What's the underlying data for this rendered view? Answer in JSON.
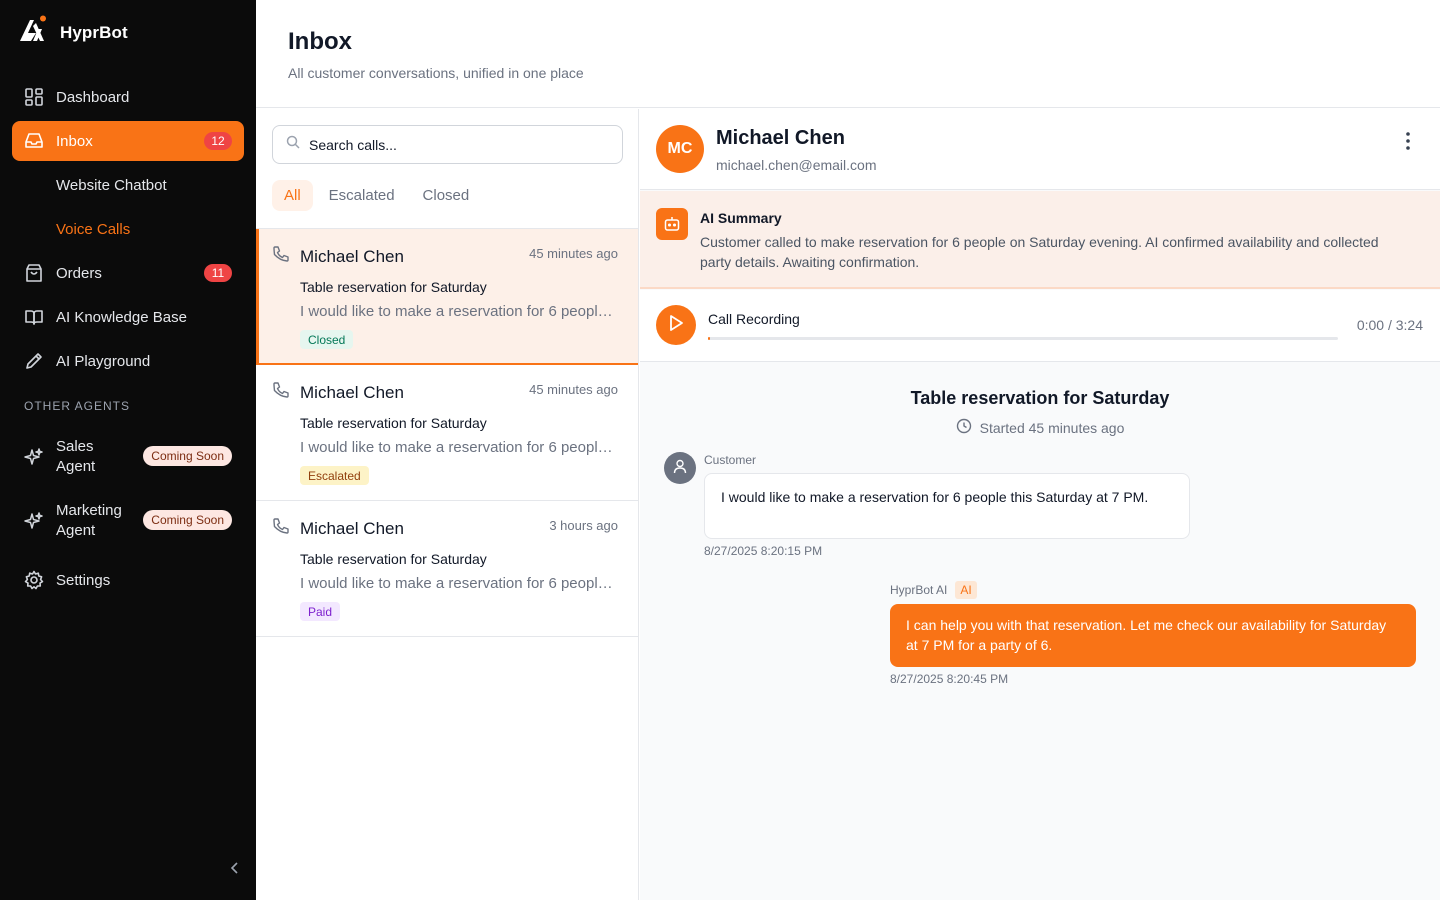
{
  "brand": {
    "name": "HyprBot",
    "logo_icon": "hyprbot-logo"
  },
  "sidebar": {
    "items": [
      {
        "label": "Dashboard",
        "icon": "dashboard-icon"
      },
      {
        "label": "Inbox",
        "icon": "inbox-icon",
        "badge": "12",
        "active": true
      },
      {
        "label": "Orders",
        "icon": "bag-icon",
        "badge": "11"
      },
      {
        "label": "AI Knowledge Base",
        "icon": "book-icon"
      },
      {
        "label": "AI Playground",
        "icon": "pencil-icon"
      }
    ],
    "sub_items": [
      {
        "label": "Website Chatbot"
      },
      {
        "label": "Voice Calls",
        "current": true
      }
    ],
    "section_label": "OTHER AGENTS",
    "agents": [
      {
        "line1": "Sales",
        "line2": "Agent",
        "badge": "Coming Soon",
        "icon": "sparkle-icon"
      },
      {
        "line1": "Marketing",
        "line2": "Agent",
        "badge": "Coming Soon",
        "icon": "sparkle-icon"
      }
    ],
    "settings_label": "Settings"
  },
  "header": {
    "title": "Inbox",
    "subtitle": "All customer conversations, unified in one place"
  },
  "list": {
    "search_placeholder": "Search calls...",
    "filters": [
      "All",
      "Escalated",
      "Closed"
    ],
    "active_filter": "All",
    "conversations": [
      {
        "name": "Michael Chen",
        "time": "45 minutes ago",
        "subject": "Table reservation for Saturday",
        "preview": "I would like to make a reservation for 6 people this Saturday at 7 PM.",
        "tag": "Closed",
        "selected": true
      },
      {
        "name": "Michael Chen",
        "time": "45 minutes ago",
        "subject": "Table reservation for Saturday",
        "preview": "I would like to make a reservation for 6 people this Saturday at 7 PM.",
        "tag": "Escalated"
      },
      {
        "name": "Michael Chen",
        "time": "3 hours ago",
        "subject": "Table reservation for Saturday",
        "preview": "I would like to make a reservation for 6 people this Saturday at 7 PM.",
        "tag": "Paid"
      }
    ]
  },
  "detail": {
    "contact": {
      "initials": "MC",
      "name": "Michael Chen",
      "email": "michael.chen@email.com"
    },
    "ai_summary": {
      "title": "AI Summary",
      "text": "Customer called to make reservation for 6 people on Saturday evening. AI confirmed availability and collected party details. Awaiting confirmation."
    },
    "recording": {
      "title": "Call Recording",
      "time": "0:00 / 3:24",
      "progress": 0.0
    },
    "chat": {
      "title": "Table reservation for Saturday",
      "started": "Started 45 minutes ago",
      "customer": {
        "label": "Customer",
        "text": "I would like to make a reservation for 6 people this Saturday at 7 PM.",
        "time": "8/27/2025 8:20:15 PM"
      },
      "ai": {
        "label": "HyprBot AI",
        "chip": "AI",
        "text": "I can help you with that reservation. Let me check our availability for Saturday at 7 PM for a party of 6.",
        "time": "8/27/2025 8:20:45 PM"
      }
    }
  },
  "colors": {
    "accent": "#f97316",
    "sidebar_bg": "#0b0b0b",
    "badge_red": "#ef4444",
    "tag_closed_bg": "#e6f6ef",
    "tag_closed_fg": "#047857",
    "tag_escalated_bg": "#fdf3c7",
    "tag_escalated_fg": "#92400e",
    "tag_paid_bg": "#f3e8ff",
    "tag_paid_fg": "#7e22ce"
  }
}
